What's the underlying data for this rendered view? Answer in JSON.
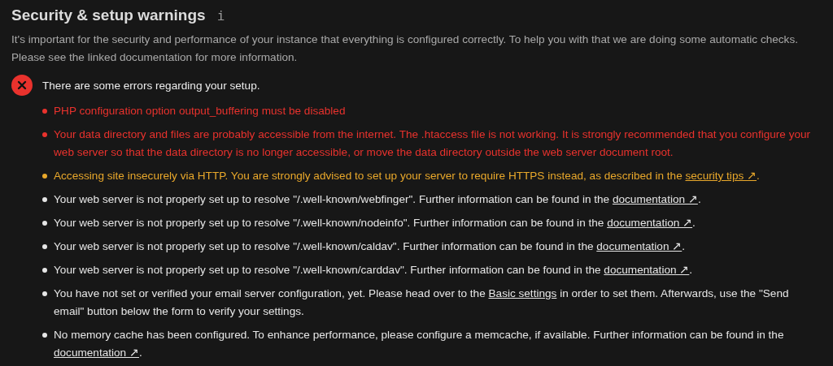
{
  "section": {
    "title": "Security & setup warnings",
    "info_icon": "i",
    "description": "It's important for the security and performance of your instance that everything is configured correctly. To help you with that we are doing some automatic checks. Please see the linked documentation for more information."
  },
  "status": {
    "kind": "error",
    "message": "There are some errors regarding your setup."
  },
  "items": [
    {
      "kind": "error",
      "text": "PHP configuration option output_buffering must be disabled"
    },
    {
      "kind": "error",
      "text": "Your data directory and files are probably accessible from the internet. The .htaccess file is not working. It is strongly recommended that you configure your web server so that the data directory is no longer accessible, or move the data directory outside the web server document root."
    },
    {
      "kind": "warning",
      "text": "Accessing site insecurely via HTTP. You are strongly advised to set up your server to require HTTPS instead, as described in the ",
      "link": "security tips ↗",
      "after": "."
    },
    {
      "kind": "info",
      "text": "Your web server is not properly set up to resolve \"/.well-known/webfinger\". Further information can be found in the ",
      "link": "documentation ↗",
      "after": "."
    },
    {
      "kind": "info",
      "text": "Your web server is not properly set up to resolve \"/.well-known/nodeinfo\". Further information can be found in the ",
      "link": "documentation ↗",
      "after": "."
    },
    {
      "kind": "info",
      "text": "Your web server is not properly set up to resolve \"/.well-known/caldav\". Further information can be found in the ",
      "link": "documentation ↗",
      "after": "."
    },
    {
      "kind": "info",
      "text": "Your web server is not properly set up to resolve \"/.well-known/carddav\". Further information can be found in the ",
      "link": "documentation ↗",
      "after": "."
    },
    {
      "kind": "info",
      "text": "You have not set or verified your email server configuration, yet. Please head over to the ",
      "link": "Basic settings",
      "after": " in order to set them. Afterwards, use the \"Send email\" button below the form to verify your settings."
    },
    {
      "kind": "info",
      "text": "No memory cache has been configured. To enhance performance, please configure a memcache, if available. Further information can be found in the ",
      "link": "documentation ↗",
      "after": "."
    }
  ]
}
